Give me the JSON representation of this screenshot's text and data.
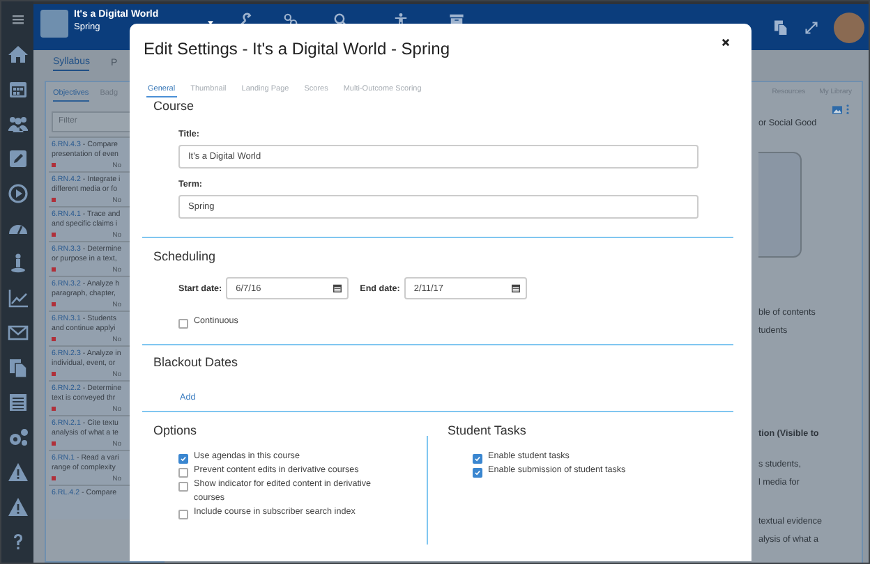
{
  "top_bar": {
    "course_title": "It's a Digital World",
    "course_term": "Spring"
  },
  "page_tabs": [
    {
      "label": "Syllabus",
      "selected": true
    },
    {
      "label": "P",
      "selected": false
    }
  ],
  "objectives_panel": {
    "tabs": [
      {
        "label": "Objectives",
        "selected": true
      },
      {
        "label": "Badg",
        "selected": false
      }
    ],
    "filter": {
      "placeholder": "Filter"
    },
    "items": [
      {
        "code": "6.RN.4.3",
        "text": " - Compare",
        "line_2": "presentation of even",
        "status": "No"
      },
      {
        "code": "6.RN.4.2",
        "text": " - Integrate i",
        "line_2": "different media or fo",
        "status": "No"
      },
      {
        "code": "6.RN.4.1",
        "text": " - Trace and",
        "line_2": "and specific claims i",
        "status": "No"
      },
      {
        "code": "6.RN.3.3",
        "text": " - Determine",
        "line_2": "or purpose in a text,",
        "status": "No"
      },
      {
        "code": "6.RN.3.2",
        "text": " - Analyze h",
        "line_2": "paragraph, chapter,",
        "status": "No"
      },
      {
        "code": "6.RN.3.1",
        "text": " - Students",
        "line_2": "and continue applyi",
        "status": "No"
      },
      {
        "code": "6.RN.2.3",
        "text": " - Analyze in",
        "line_2": "individual, event, or",
        "status": "No"
      },
      {
        "code": "6.RN.2.2",
        "text": " - Determine",
        "line_2": "text is conveyed thr",
        "status": "No"
      },
      {
        "code": "6.RN.2.1",
        "text": " - Cite textu",
        "line_2": "analysis of what a te",
        "status": "No"
      },
      {
        "code": "6.RN.1",
        "text": " - Read a vari",
        "line_2": "range of complexity",
        "status": "No"
      },
      {
        "code": "6.RL.4.2",
        "text": " - Compare"
      }
    ]
  },
  "resources_panel": {
    "tabs": [
      "Resources",
      "My Library"
    ],
    "blocks": [
      {
        "kind": "text",
        "lines": [
          "or Social Good"
        ]
      },
      {
        "kind": "image"
      },
      {
        "kind": "text",
        "lines": [
          "ble of contents",
          "tudents"
        ]
      },
      {
        "kind": "bold",
        "lines": [
          "tion (Visible to"
        ]
      },
      {
        "kind": "text",
        "lines": [
          "s students,",
          "l media for"
        ]
      },
      {
        "kind": "text",
        "lines": [
          "textual evidence",
          "alysis of what a"
        ]
      }
    ]
  },
  "dialog": {
    "title": "Edit Settings - It's a Digital World - Spring",
    "tabs": [
      {
        "label": "General",
        "selected": true
      },
      {
        "label": "Thumbnail",
        "selected": false
      },
      {
        "label": "Landing Page",
        "selected": false
      },
      {
        "label": "Scores",
        "selected": false
      },
      {
        "label": "Multi-Outcome Scoring",
        "selected": false
      }
    ],
    "course": {
      "heading": "Course",
      "fields": [
        {
          "label": "Title:",
          "value": "It's a Digital World"
        },
        {
          "label": "Term:",
          "value": "Spring"
        }
      ]
    },
    "scheduling": {
      "heading": "Scheduling",
      "start": {
        "label": "Start date:",
        "value": "6/7/16"
      },
      "end": {
        "label": "End date:",
        "value": "2/11/17"
      },
      "continuous": {
        "label": "Continuous",
        "checked": false
      }
    },
    "blackout": {
      "heading": "Blackout Dates",
      "add": "Add"
    },
    "options": {
      "heading": "Options",
      "items": [
        {
          "label": "Use agendas in this course",
          "checked": true
        },
        {
          "label": "Prevent content edits in derivative courses",
          "checked": false
        },
        {
          "label": "Show indicator for edited content in derivative courses",
          "checked": false
        },
        {
          "label": "Include course in subscriber search index",
          "checked": false
        }
      ]
    },
    "student_tasks": {
      "heading": "Student Tasks",
      "items": [
        {
          "label": "Enable student tasks",
          "checked": true
        },
        {
          "label": "Enable submission of student tasks",
          "checked": true
        }
      ]
    }
  }
}
